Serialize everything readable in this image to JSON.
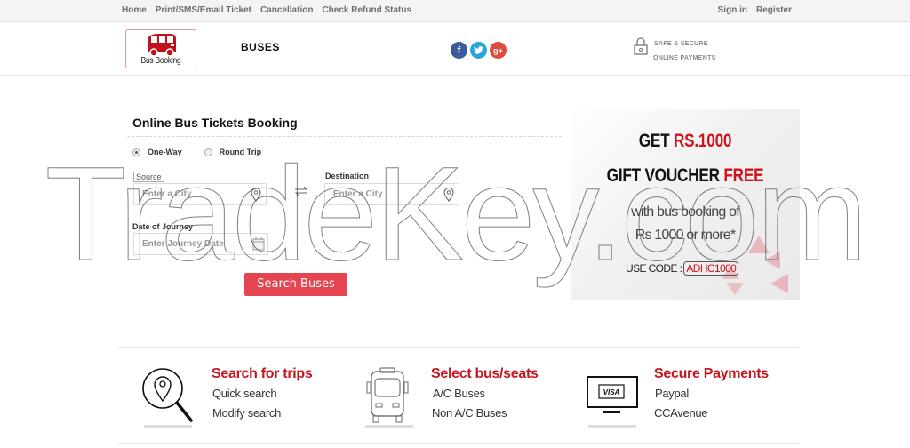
{
  "top_nav": {
    "left_links": [
      "Home",
      "Print/SMS/Email Ticket",
      "Cancellation",
      "Check Refund Status"
    ],
    "right_links": [
      "Sign in",
      "Register"
    ]
  },
  "header": {
    "logo_text": "Bus Booking",
    "buses_label": "BUSES",
    "social": {
      "facebook": "f",
      "twitter": "t",
      "googleplus": "g+"
    },
    "secure_line1": "SAFE & SECURE",
    "secure_line2": "ONLINE PAYMENTS"
  },
  "booking_form": {
    "title": "Online Bus Tickets Booking",
    "trip_types": [
      {
        "label": "One-Way",
        "checked": true
      },
      {
        "label": "Round Trip",
        "checked": false
      }
    ],
    "source": {
      "label": "Source",
      "placeholder": "Enter a City"
    },
    "destination": {
      "label": "Destination",
      "placeholder": "Enter a City"
    },
    "date": {
      "label": "Date of Journey",
      "placeholder": "Enter Journey Date"
    },
    "search_button": "Search Buses"
  },
  "promo": {
    "get": "GET",
    "amount": "RS.1000",
    "gift_voucher": "GIFT VOUCHER",
    "free": "FREE",
    "line3": "with bus booking of",
    "line4": "Rs 1000 or more*",
    "use_code": "USE CODE :",
    "code": "ADHC1000"
  },
  "features": [
    {
      "title": "Search for trips",
      "items": [
        "Quick search",
        "Modify search"
      ],
      "icon": "search-location-icon"
    },
    {
      "title": "Select bus/seats",
      "items": [
        "A/C Buses",
        "Non A/C Buses"
      ],
      "icon": "bus-front-icon"
    },
    {
      "title": "Secure Payments",
      "items": [
        "Paypal",
        "CCAvenue"
      ],
      "icon": "visa-monitor-icon"
    }
  ],
  "watermark": "TradeKey.com",
  "colors": {
    "accent_red": "#c6161f",
    "button_red": "#e44550",
    "facebook": "#3b5b9a",
    "twitter": "#2aa4d9",
    "googleplus": "#e04a3a"
  }
}
